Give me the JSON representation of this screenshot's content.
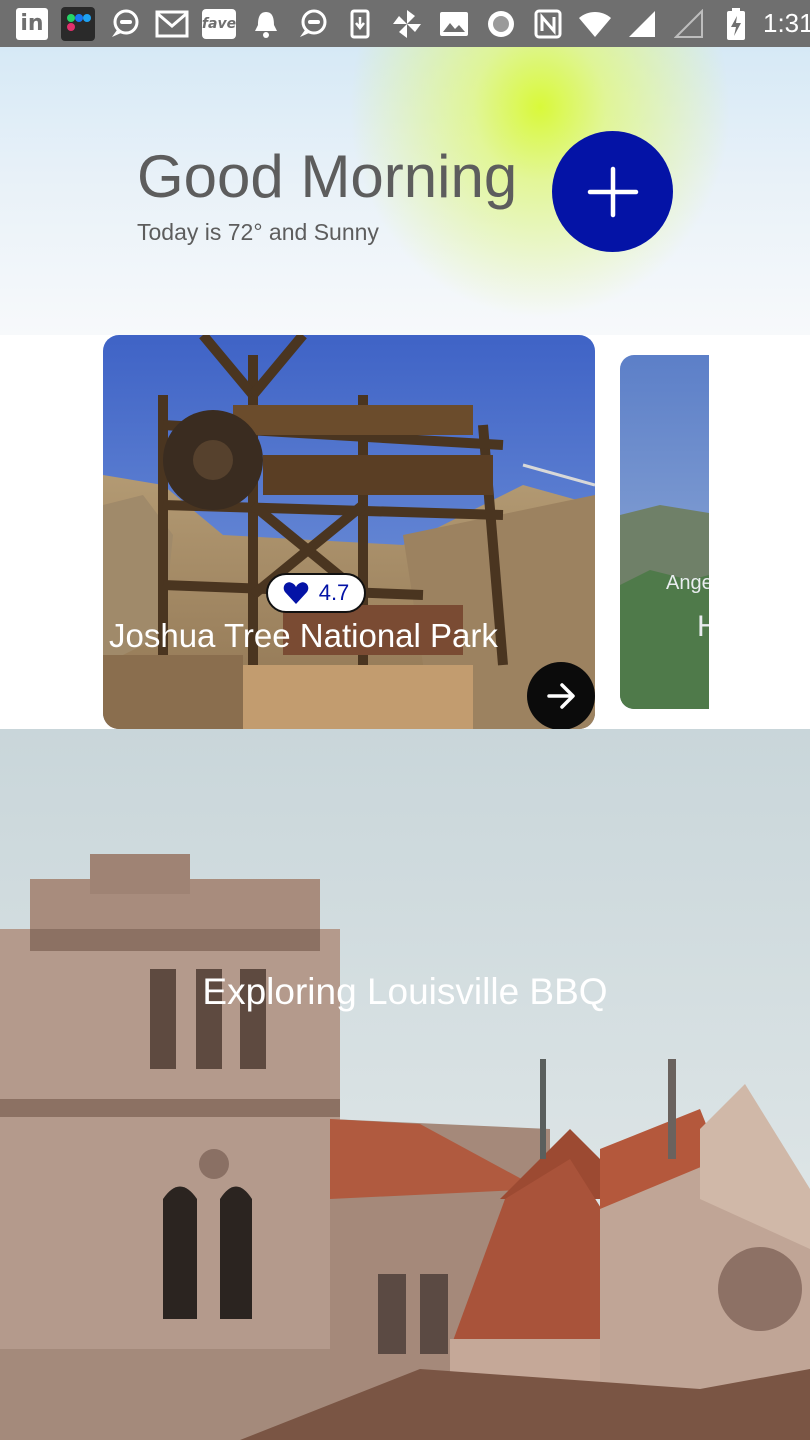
{
  "status_bar": {
    "time": "1:31",
    "left_icons": [
      "linkedin-icon",
      "social-apps-icon",
      "chat-icon",
      "gmail-icon",
      "fave-icon",
      "notification-bell-icon",
      "chat-icon",
      "download-icon",
      "pinwheel-icon",
      "image-icon",
      "record-icon"
    ],
    "right_icons": [
      "nfc-icon",
      "wifi-icon",
      "signal-icon",
      "signal-weak-icon",
      "battery-charging-icon"
    ],
    "linkedin_text": "in",
    "fave_text": "fave"
  },
  "header": {
    "greeting": "Good Morning",
    "weather": "Today is 72° and Sunny",
    "add_button_icon": "plus-icon",
    "accent_color": "#0413a6",
    "glow_color": "#d9f93a"
  },
  "carousel": {
    "cards": [
      {
        "title": "Joshua Tree National Park",
        "rating": "4.7",
        "rating_icon": "heart-icon",
        "action_icon": "arrow-right-icon"
      },
      {
        "subtitle": "Ange",
        "title": "H"
      }
    ]
  },
  "feature": {
    "title": "Exploring Louisville BBQ"
  }
}
